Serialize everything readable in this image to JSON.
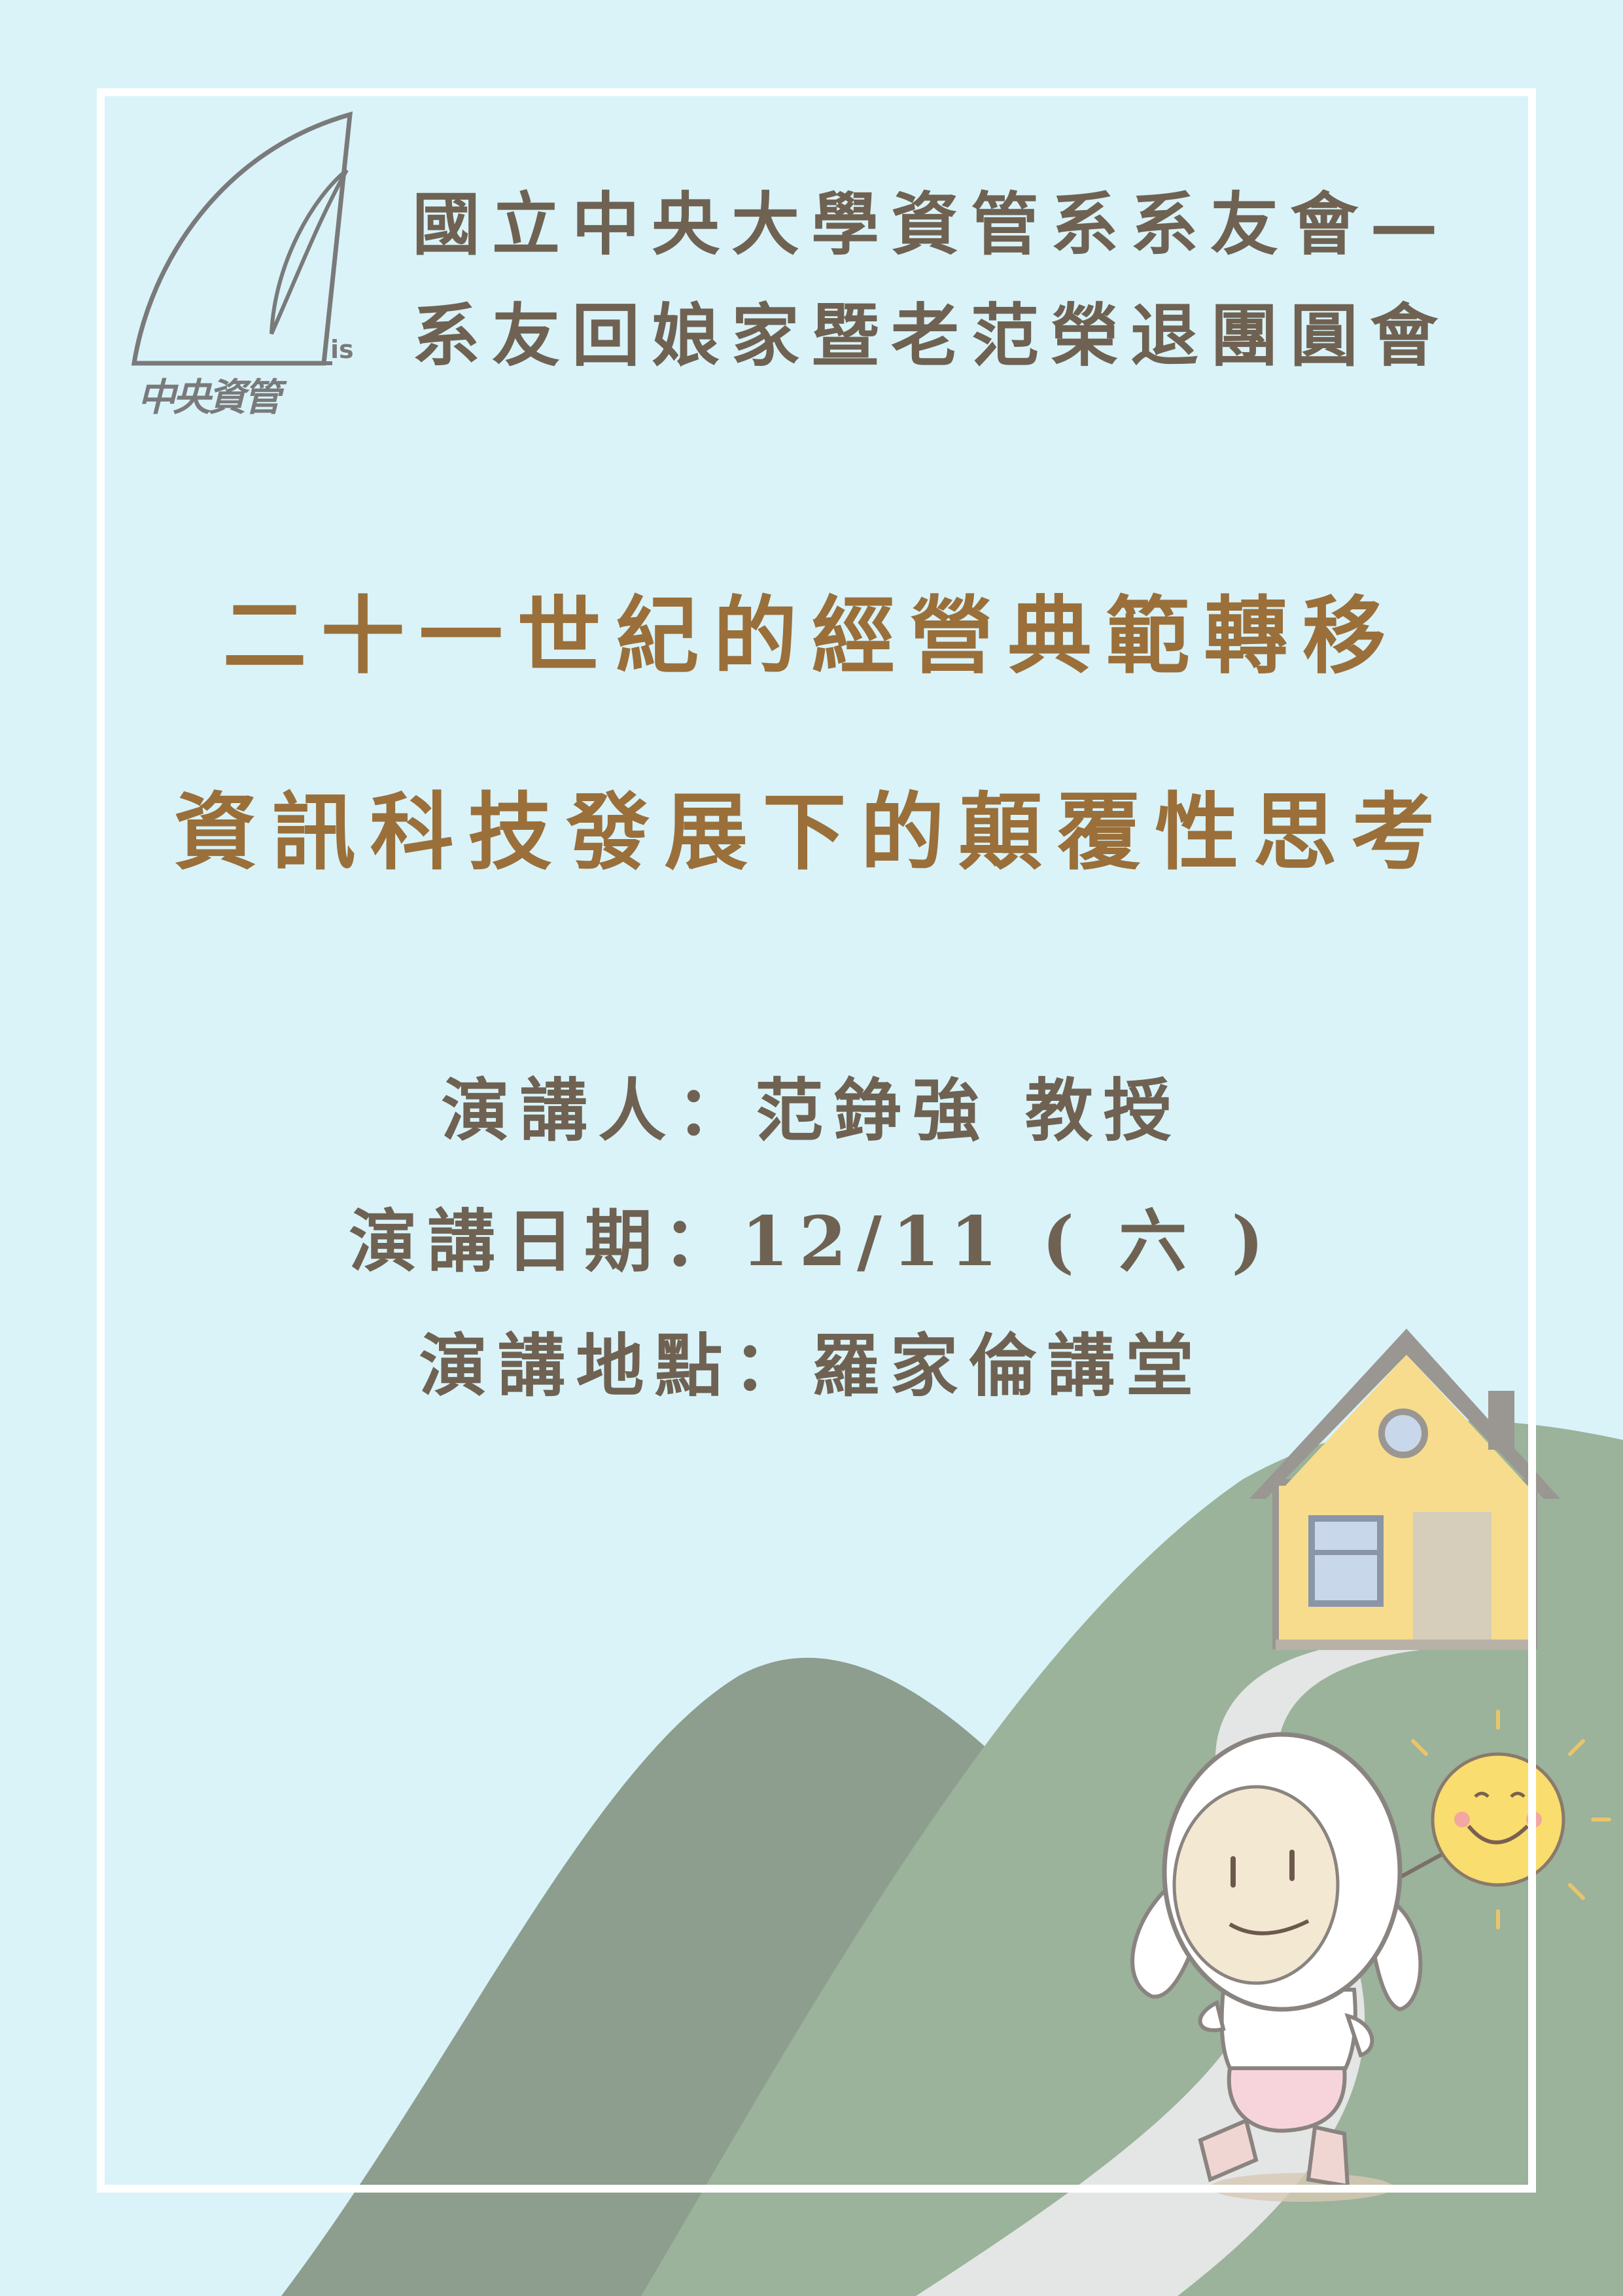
{
  "organization": {
    "logo_caption": "中央資管",
    "logo_suffix": "is",
    "line1": "國立中央大學資管系系友會—",
    "line2": "系友回娘家暨老范榮退團圓會"
  },
  "talk": {
    "title_line1": "二十一世紀的經營典範轉移",
    "title_line2": "資訊科技發展下的顛覆性思考"
  },
  "details": {
    "speaker": "演講人：范錚強 教授",
    "date": "演講日期：12/11 ( 六 )",
    "venue": "演講地點：羅家倫講堂"
  },
  "colors": {
    "background": "#d9f3f9",
    "title": "#9a6f3a",
    "text": "#6f6252",
    "hill_back": "#8d9d8e",
    "hill_front": "#9bb29b",
    "house_wall": "#f6dc8c",
    "house_roof": "#9a9692"
  }
}
